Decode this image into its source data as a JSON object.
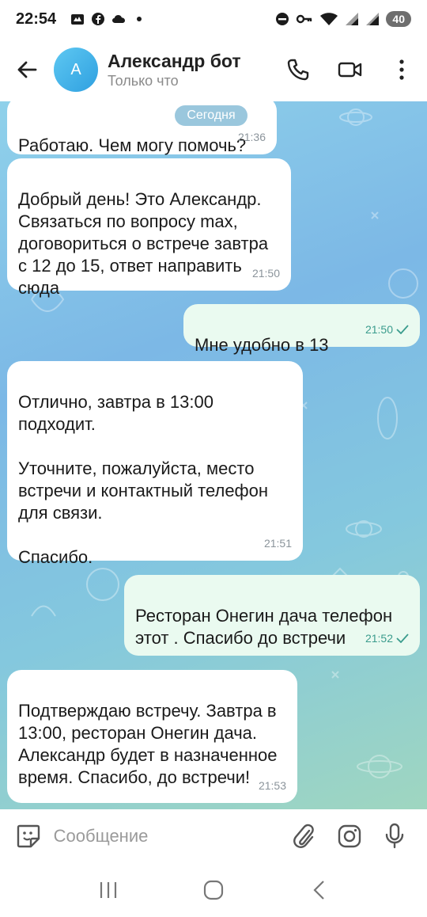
{
  "status_bar": {
    "time": "22:54",
    "battery": "40",
    "left_icons": [
      "mail-app-icon",
      "facebook-icon",
      "cloud-icon",
      "dot-icon"
    ],
    "right_icons": [
      "do-not-disturb-icon",
      "key-icon",
      "wifi-icon",
      "signal-icon",
      "signal-icon-2"
    ]
  },
  "header": {
    "avatar_letter": "А",
    "title": "Александр бот",
    "subtitle": "Только что"
  },
  "chat": {
    "date_chip": "Сегодня",
    "messages": [
      {
        "direction": "in",
        "text": "Работаю. Чем могу помочь?",
        "time": "21:36"
      },
      {
        "direction": "in",
        "text": "Добрый день! Это Александр. Связаться по вопросу max, договориться о встрече завтра с 12 до 15, ответ направить сюда",
        "time": "21:50"
      },
      {
        "direction": "out",
        "text": "Мне удобно в 13",
        "time": "21:50"
      },
      {
        "direction": "in",
        "text": "Отлично, завтра в 13:00 подходит.\n\nУточните, пожалуйста, место встречи и контактный телефон для связи.\n\nСпасибо.",
        "time": "21:51"
      },
      {
        "direction": "out",
        "text": "Ресторан Онегин дача телефон этот . Спасибо до встречи",
        "time": "21:52"
      },
      {
        "direction": "in",
        "text": "Подтверждаю встречу. Завтра в 13:00, ресторан Онегин дача. Александр будет в назначенное время. Спасибо, до встречи!",
        "time": "21:53"
      }
    ]
  },
  "input": {
    "placeholder": "Сообщение"
  },
  "colors": {
    "accent": "#2fa0e0",
    "outgoing_bubble": "#eafaf0",
    "incoming_bubble": "#ffffff",
    "check_mark": "#3b9c8d"
  }
}
